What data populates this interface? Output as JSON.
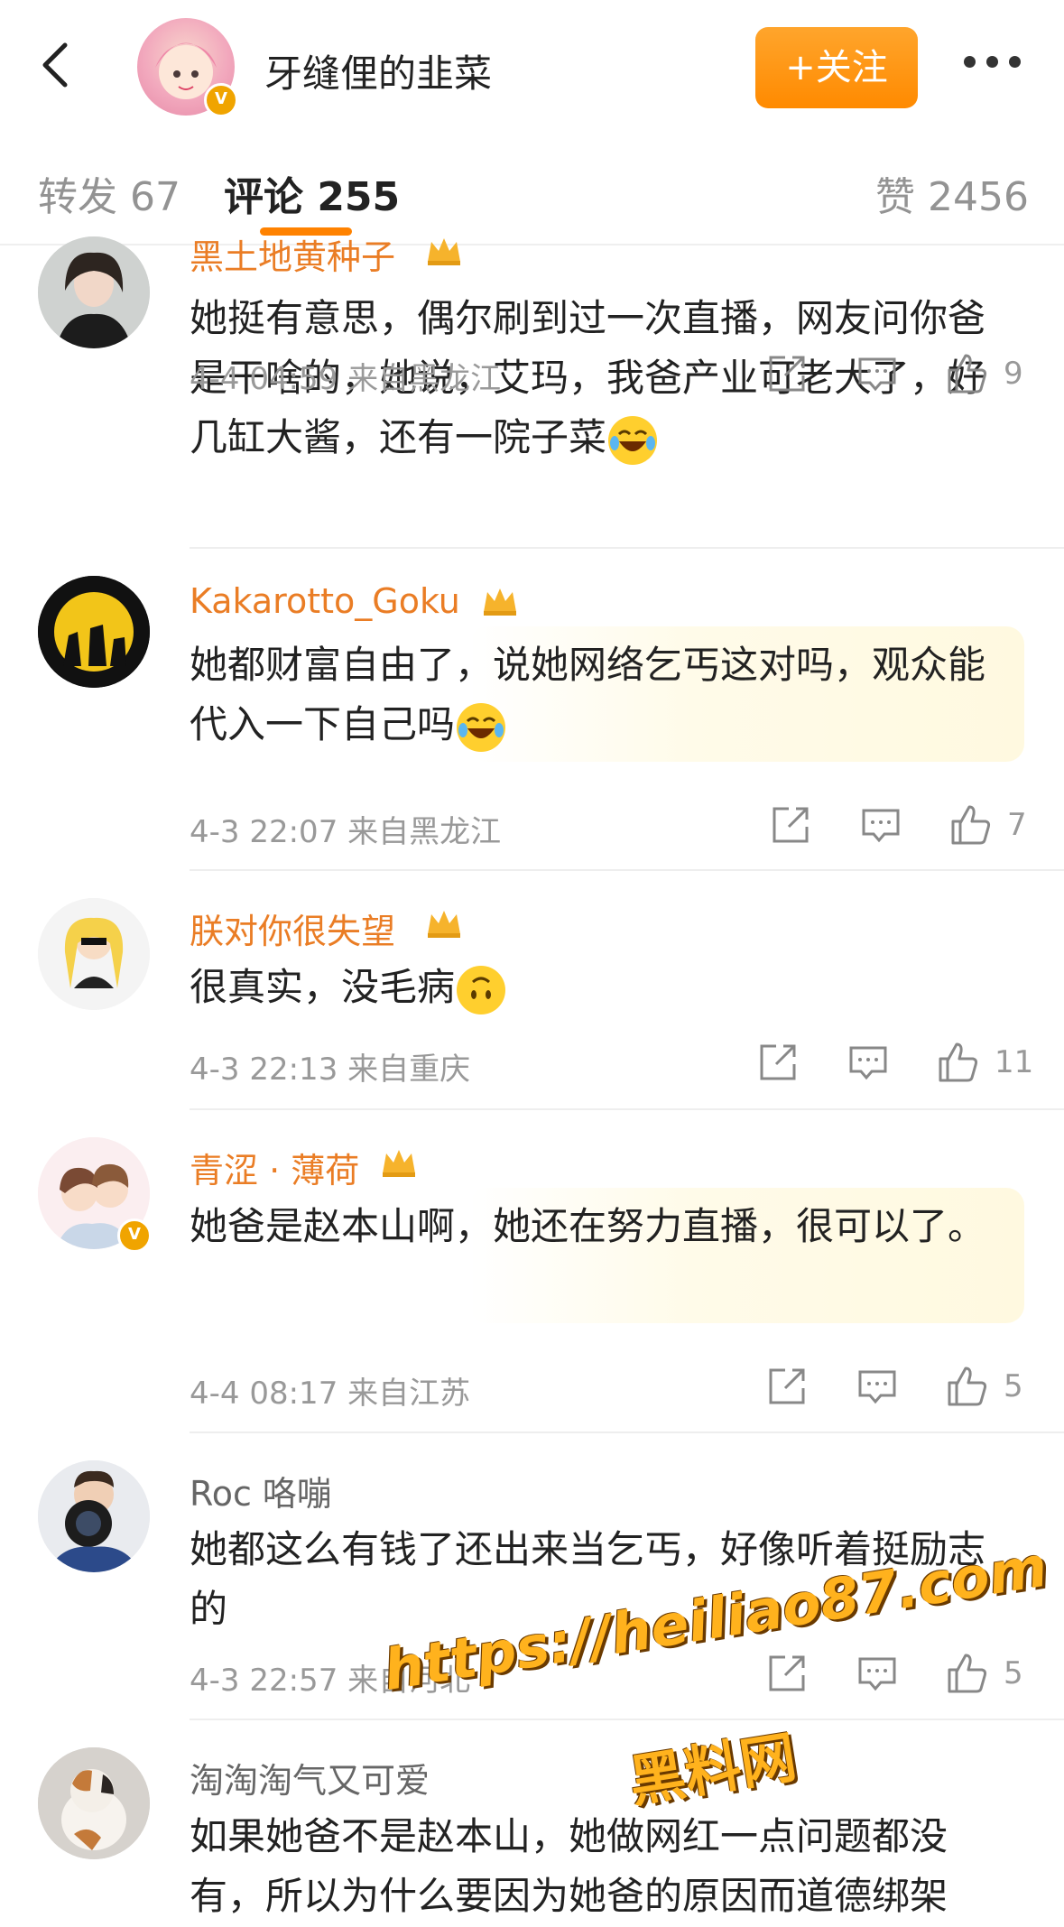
{
  "header": {
    "title": "牙缝俚的韭菜",
    "follow_label": "+关注",
    "verified_badge": "V"
  },
  "tabs": {
    "repost": "转发 67",
    "comments": "评论 255",
    "likes": "赞 2456"
  },
  "comments": [
    {
      "user": "黑土地黄种子",
      "text": "她挺有意思，偶尔刷到过一次直播，网友问你爸是干啥的，她说，艾玛，我爸产业可老大了，好几缸大酱，还有一院子菜",
      "time": "4-4 04:59 来自黑龙江",
      "likes": "9"
    },
    {
      "user": "Kakarotto_Goku",
      "text": "她都财富自由了，说她网络乞丐这对吗，观众能代入一下自己吗",
      "time": "4-3 22:07 来自黑龙江",
      "likes": "7"
    },
    {
      "user": "朕对你很失望",
      "text": "很真实，没毛病",
      "time": "4-3 22:13 来自重庆",
      "likes": "11"
    },
    {
      "user": "青涩 · 薄荷",
      "text": "她爸是赵本山啊，她还在努力直播，很可以了。",
      "time": "4-4 08:17 来自江苏",
      "likes": "5"
    },
    {
      "user": "Roc 咯嘣",
      "text": "她都这么有钱了还出来当乞丐，好像听着挺励志的",
      "time": "4-3 22:57 来自河北",
      "likes": "5"
    },
    {
      "user": "淘淘淘气又可爱",
      "text": "如果她爸不是赵本山，她做网红一点问题都没有，所以为什么要因为她爸的原因而道德绑架",
      "time": "",
      "likes": ""
    }
  ],
  "watermark": {
    "url": "https://heiliao87.com",
    "name": "黑料网"
  },
  "icons": [
    "back-arrow-icon",
    "more-icon",
    "share-icon",
    "reply-icon",
    "like-icon",
    "crown-icon",
    "emoji-laugh-icon",
    "emoji-upside-icon"
  ],
  "colors": {
    "accent": "#ff8200",
    "username": "#ea7d25",
    "meta": "#999999"
  }
}
